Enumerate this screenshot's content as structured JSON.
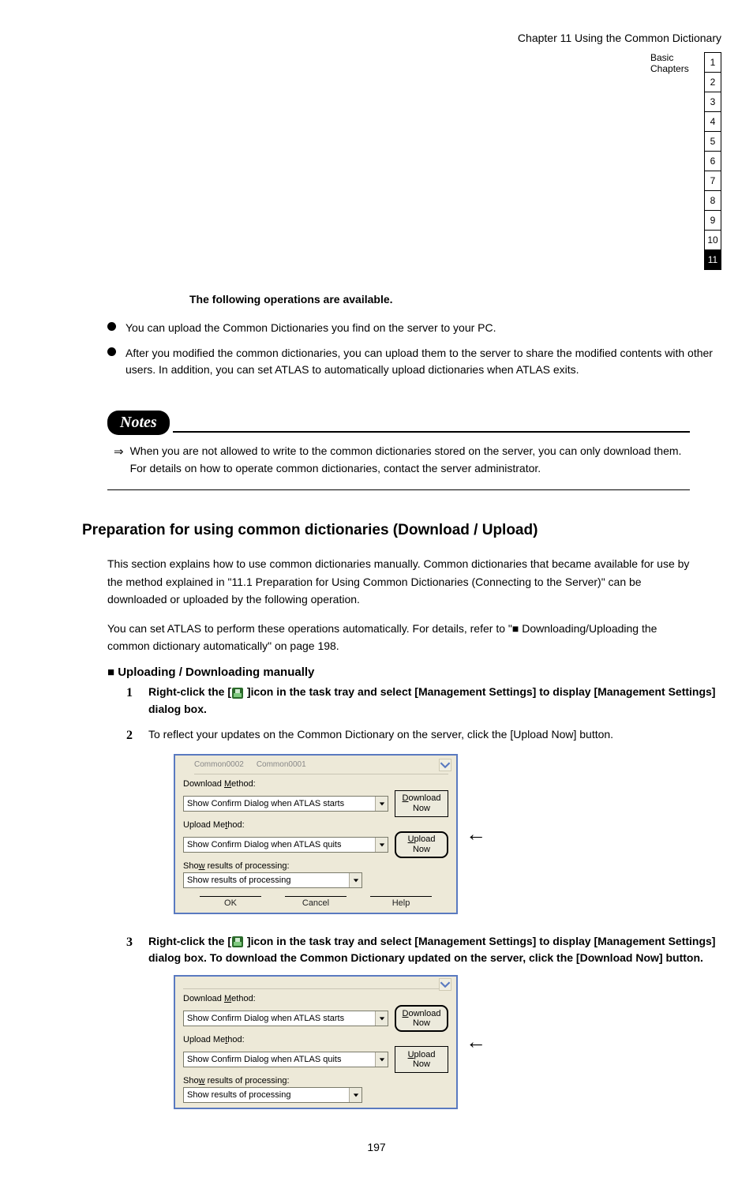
{
  "header": {
    "right_text": "Chapter 11   Using the Common Dictionary",
    "chapter_label_line1": "Basic",
    "chapter_label_line2": "Chapters",
    "boxes": [
      "1",
      "2",
      "3",
      "4",
      "5",
      "6",
      "7",
      "8",
      "9",
      "10",
      "11"
    ],
    "active_box_index": 10
  },
  "intro_line": "The following operations are available.",
  "bullets": [
    "You can upload the Common Dictionaries you find on the server to your PC.",
    "After you modified the common dictionaries, you can upload them to the server to share the modified contents with other users. In addition, you can set ATLAS to automatically upload dictionaries when ATLAS exits."
  ],
  "notes_badge": "Notes",
  "notes_text": "When you are not allowed to write to the common dictionaries stored on the server, you can only download them. For details on how to operate common dictionaries, contact the server administrator.",
  "section_title": "Preparation for using common dictionaries (Download / Upload)",
  "paragraphs": [
    "This section explains how to use common dictionaries manually. Common dictionaries that became available for use by the method explained in \"11.1 Preparation for Using Common Dictionaries (Connecting to the Server)\" can be downloaded or uploaded by the following operation.",
    "You can set ATLAS to perform these operations automatically. For details, refer to \"■ Downloading/Uploading the common dictionary automatically\" on page 198."
  ],
  "sub_title": "■ Uploading / Downloading manually",
  "steps": [
    {
      "num": "1",
      "pre": "Right-click the [",
      "icon": true,
      "post": " ]icon in the task tray and select [Management Settings] to display [Management Settings] dialog box."
    },
    {
      "num": "2",
      "pre": "To reflect your updates on the Common Dictionary on the server, click the [Upload Now] button.",
      "icon": false,
      "post": ""
    },
    {
      "num": "3",
      "pre": "To download the Common Dictionary updated on the server, click the [Download Now] button.",
      "icon": false,
      "post": ""
    }
  ],
  "screenshot_labels": {
    "dim1": "Common0002",
    "dim2": "Common0001",
    "dl_method": "Download Method:",
    "dl_combo": "Show Confirm Dialog when ATLAS starts",
    "dl_btn_l1": "Download",
    "dl_btn_l2": "Now",
    "ul_method": "Upload Method:",
    "ul_combo": "Show Confirm Dialog when ATLAS quits",
    "ul_btn_l1": "Upload",
    "ul_btn_l2": "Now",
    "results_label": "Show results of processing:",
    "results_combo": "Show results of processing",
    "ok": "OK",
    "cancel": "Cancel",
    "help": "Help"
  },
  "page_number": "197"
}
